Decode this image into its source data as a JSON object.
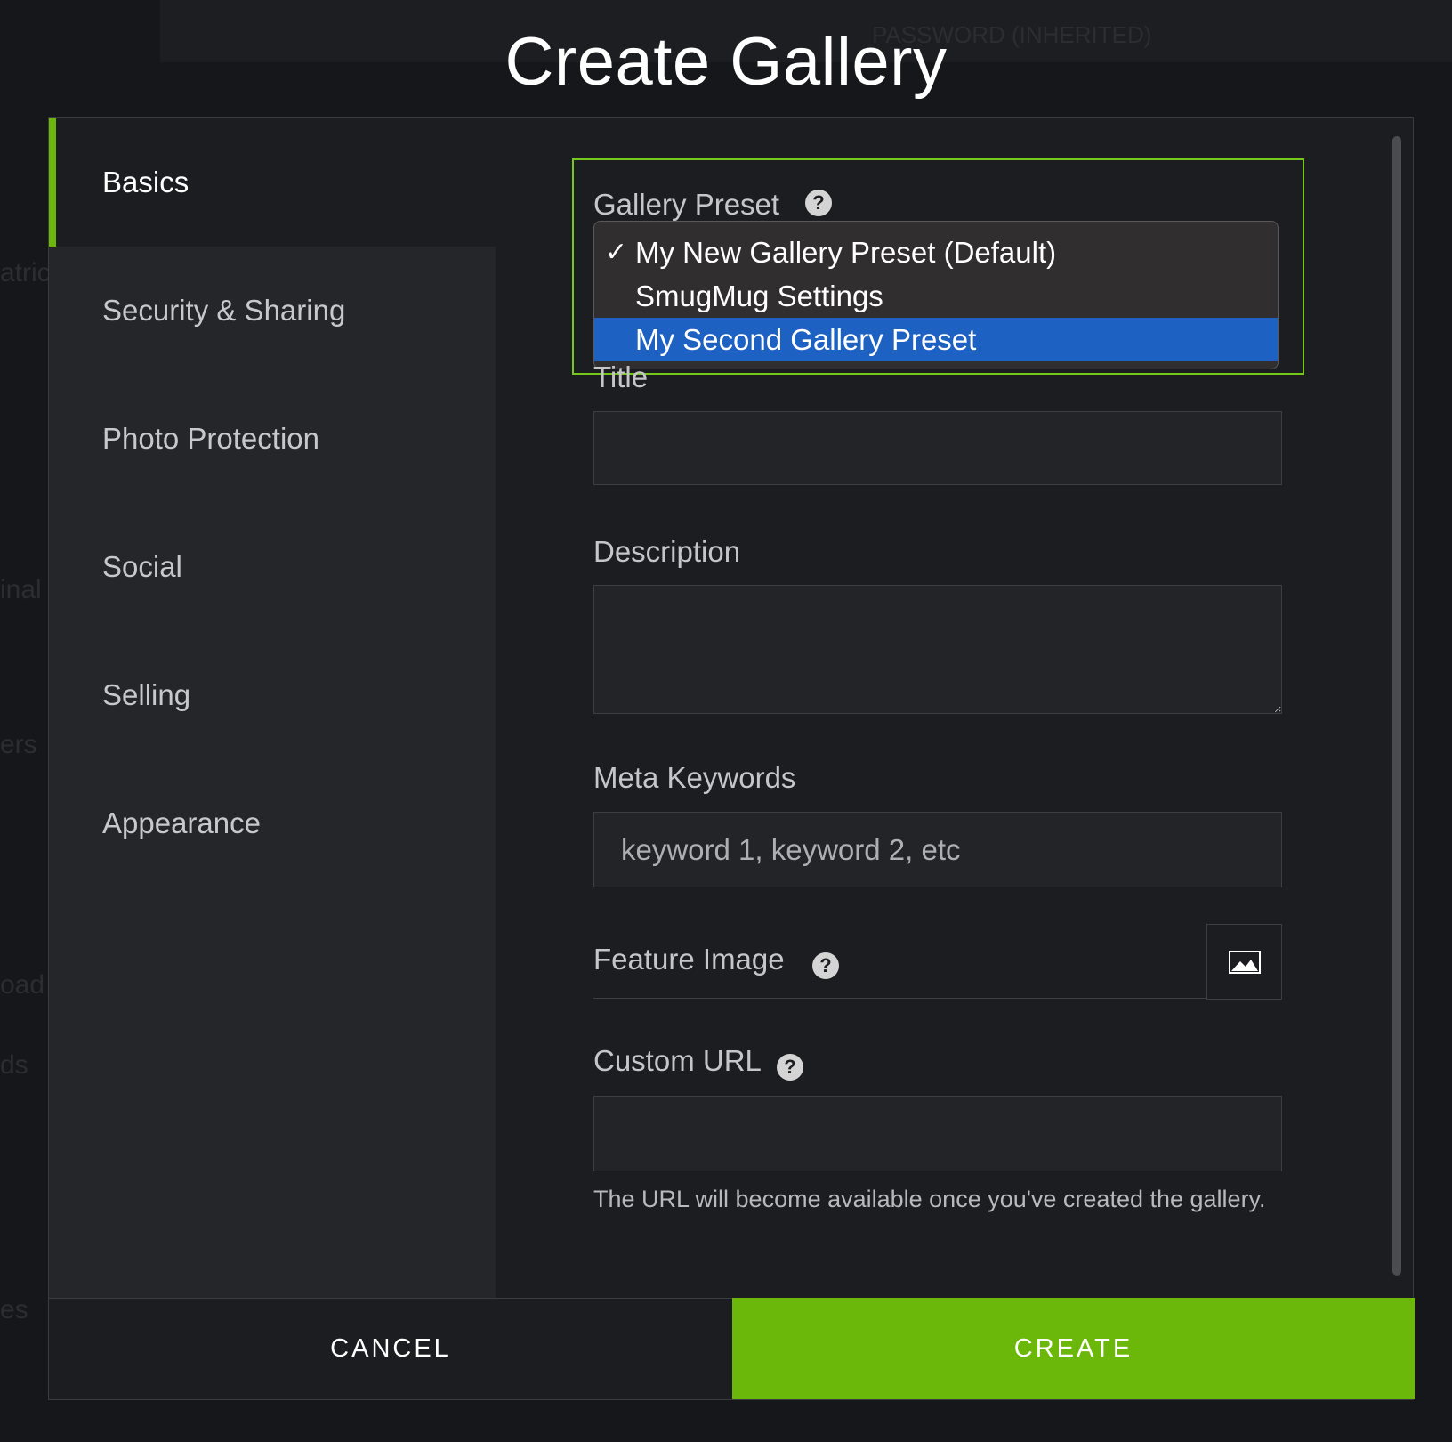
{
  "background": {
    "top_label": "PASSWORD (INHERITED)",
    "side_fragments": [
      "atric",
      "inal",
      "ers",
      "oad",
      "ds",
      "es"
    ]
  },
  "dialog": {
    "title": "Create Gallery"
  },
  "sidebar": {
    "items": [
      {
        "label": "Basics",
        "active": true
      },
      {
        "label": "Security & Sharing"
      },
      {
        "label": "Photo Protection"
      },
      {
        "label": "Social"
      },
      {
        "label": "Selling"
      },
      {
        "label": "Appearance"
      }
    ]
  },
  "form": {
    "gallery_preset": {
      "label": "Gallery Preset",
      "options": [
        {
          "label": "My New Gallery Preset (Default)",
          "checked": true
        },
        {
          "label": "SmugMug Settings"
        },
        {
          "label": "My Second Gallery Preset",
          "highlighted": true
        }
      ],
      "check_glyph": "✓"
    },
    "title": {
      "label": "Title",
      "value": ""
    },
    "description": {
      "label": "Description",
      "value": ""
    },
    "meta_keywords": {
      "label": "Meta Keywords",
      "placeholder": "keyword 1, keyword 2, etc"
    },
    "feature_image": {
      "label": "Feature Image"
    },
    "custom_url": {
      "label": "Custom URL",
      "value": "",
      "hint": "The URL will become available once you've created the gallery."
    },
    "help_glyph": "?"
  },
  "footer": {
    "cancel_label": "CANCEL",
    "create_label": "CREATE"
  },
  "colors": {
    "accent": "#6bb70a",
    "highlight": "#1d62c3",
    "preset_outline": "#76c81a"
  }
}
